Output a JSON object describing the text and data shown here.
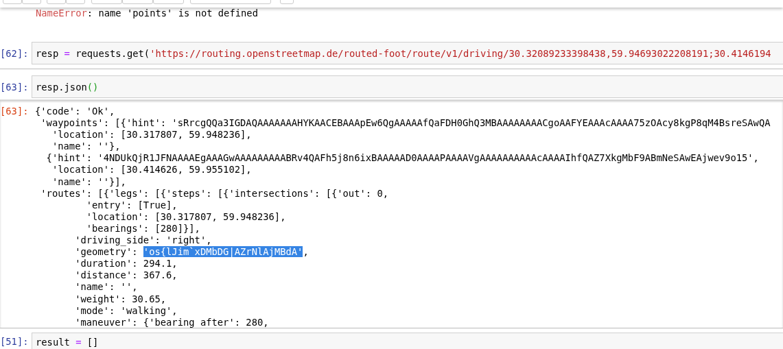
{
  "error_output": {
    "name": "NameError",
    "message": ": name 'points' is not defined"
  },
  "cells": [
    {
      "prompt": "[62]:",
      "code": [
        {
          "kind": "name",
          "text": "resp "
        },
        {
          "kind": "operator",
          "text": "="
        },
        {
          "kind": "name",
          "text": " requests.get("
        },
        {
          "kind": "string",
          "text": "'https://routing.openstreetmap.de/routed-foot/route/v1/driving/30.32089233398438,59.94693022208191;30.4146194"
        }
      ]
    },
    {
      "prompt": "[63]:",
      "code": [
        {
          "kind": "name",
          "text": "resp.json"
        },
        {
          "kind": "bracket",
          "text": "()"
        }
      ],
      "output": {
        "prompt": "[63]:",
        "lines": [
          [
            {
              "text": "{'code': 'Ok',",
              "selected": false
            }
          ],
          [
            {
              "text": " 'waypoints': [{'hint': 'sRrcgQQa3IGDAQAAAAAAAHYKAACEBAAApEw6QgAAAAAfQaFDH0GhQ3MBAAAAAAAACgoAAFYEAAAcAAAA75zOAcy8kgP8qM4BsreSAwQA",
              "selected": false
            }
          ],
          [
            {
              "text": "   'location': [30.317807, 59.948236],",
              "selected": false
            }
          ],
          [
            {
              "text": "   'name': ''},",
              "selected": false
            }
          ],
          [
            {
              "text": "  {'hint': '4NDUkQjR1JFNAAAAEgAAAGwAAAAAAAAABRv4QAFh5j8n6ixBAAAAAD0AAAAPAAAAVgAAAAAAAAAAcAAAAIhfQAZ7XkgMbF9ABmNeSAwEAjwev9o15',",
              "selected": false
            }
          ],
          [
            {
              "text": "   'location': [30.414626, 59.955102],",
              "selected": false
            }
          ],
          [
            {
              "text": "   'name': ''}],",
              "selected": false
            }
          ],
          [
            {
              "text": " 'routes': [{'legs': [{'steps': [{'intersections': [{'out': 0,",
              "selected": false
            }
          ],
          [
            {
              "text": "         'entry': [True],",
              "selected": false
            }
          ],
          [
            {
              "text": "         'location': [30.317807, 59.948236],",
              "selected": false
            }
          ],
          [
            {
              "text": "         'bearings': [280]}],",
              "selected": false
            }
          ],
          [
            {
              "text": "       'driving_side': 'right',",
              "selected": false
            }
          ],
          [
            {
              "text": "       'geometry': ",
              "selected": false
            },
            {
              "text": "'os{lJim`xDMbDG|AZrNlAjMBdA'",
              "selected": true
            },
            {
              "text": ",",
              "selected": false
            }
          ],
          [
            {
              "text": "       'duration': 294.1,",
              "selected": false
            }
          ],
          [
            {
              "text": "       'distance': 367.6,",
              "selected": false
            }
          ],
          [
            {
              "text": "       'name': '',",
              "selected": false
            }
          ],
          [
            {
              "text": "       'weight': 30.65,",
              "selected": false
            }
          ],
          [
            {
              "text": "       'mode': 'walking',",
              "selected": false
            }
          ],
          [
            {
              "text": "       'maneuver': {'bearing_after': 280,",
              "selected": false
            }
          ]
        ]
      }
    },
    {
      "prompt": "[51]:",
      "code": [
        {
          "kind": "name",
          "text": "result "
        },
        {
          "kind": "operator",
          "text": "="
        },
        {
          "kind": "name",
          "text": " []"
        }
      ]
    }
  ]
}
